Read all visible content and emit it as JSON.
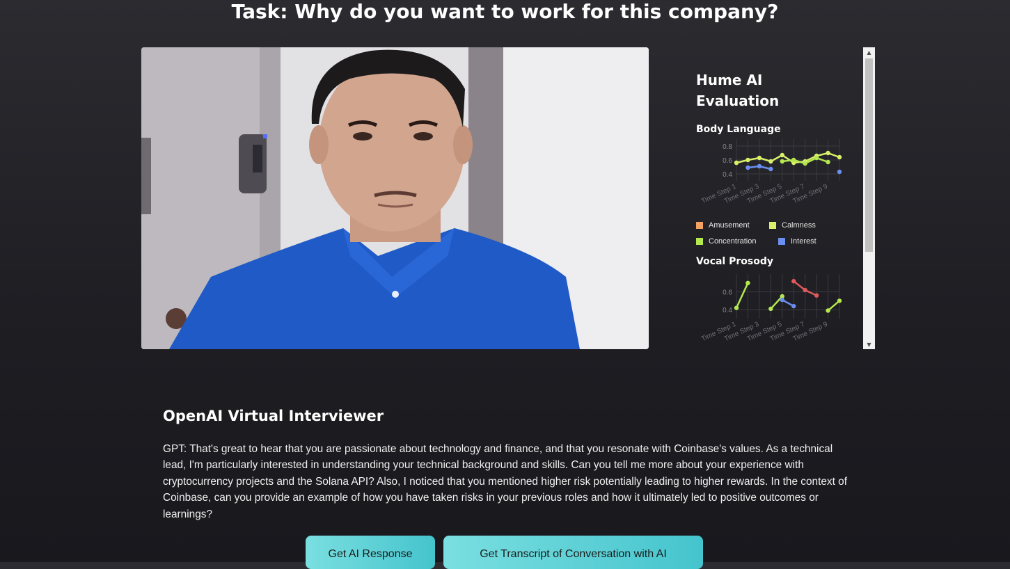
{
  "task_title": "Task: Why do you want to work for this company?",
  "evaluation": {
    "title_line1": "Hume AI",
    "title_line2": "Evaluation",
    "body_language": {
      "title": "Body Language",
      "y_ticks": [
        "0.8",
        "0.6",
        "0.4"
      ],
      "x_ticks": [
        "Time Step 1",
        "Time Step 3",
        "Time Step 5",
        "Time Step 7",
        "Time Step 9"
      ],
      "legend": [
        {
          "label": "Amusement",
          "color": "#f4a261"
        },
        {
          "label": "Calmness",
          "color": "#d9f06a"
        },
        {
          "label": "Concentration",
          "color": "#b5e84f"
        },
        {
          "label": "Interest",
          "color": "#6b8ff0"
        }
      ]
    },
    "vocal_prosody": {
      "title": "Vocal Prosody",
      "y_ticks": [
        "0.6",
        "0.4"
      ],
      "x_ticks": [
        "Time Step 1",
        "Time Step 3",
        "Time Step 5",
        "Time Step 7",
        "Time Step 9"
      ]
    }
  },
  "chart_data": [
    {
      "type": "line",
      "title": "Body Language",
      "x": [
        "Time Step 1",
        "Time Step 2",
        "Time Step 3",
        "Time Step 4",
        "Time Step 5",
        "Time Step 6",
        "Time Step 7",
        "Time Step 8",
        "Time Step 9",
        "Time Step 10"
      ],
      "ylim": [
        0.3,
        0.9
      ],
      "series": [
        {
          "name": "Amusement",
          "color": "#f4a261",
          "values": [
            0.56,
            null,
            null,
            null,
            null,
            null,
            null,
            null,
            null,
            null
          ]
        },
        {
          "name": "Calmness",
          "color": "#d9f06a",
          "values": [
            0.56,
            0.6,
            0.63,
            0.58,
            0.67,
            0.56,
            0.58,
            0.66,
            0.7,
            0.64
          ]
        },
        {
          "name": "Concentration",
          "color": "#b5e84f",
          "values": [
            null,
            null,
            null,
            null,
            0.58,
            0.6,
            0.55,
            0.63,
            0.57,
            null
          ]
        },
        {
          "name": "Interest",
          "color": "#6b8ff0",
          "values": [
            null,
            0.49,
            0.51,
            0.47,
            null,
            null,
            null,
            null,
            null,
            0.43
          ]
        }
      ]
    },
    {
      "type": "line",
      "title": "Vocal Prosody",
      "x": [
        "Time Step 1",
        "Time Step 2",
        "Time Step 3",
        "Time Step 4",
        "Time Step 5",
        "Time Step 6",
        "Time Step 7",
        "Time Step 8",
        "Time Step 9",
        "Time Step 10"
      ],
      "ylim": [
        0.3,
        0.8
      ],
      "series": [
        {
          "color": "#b5e84f",
          "values": [
            0.42,
            0.7,
            null,
            0.41,
            0.55,
            null,
            null,
            null,
            0.39,
            0.5
          ]
        },
        {
          "color": "#6b8ff0",
          "values": [
            null,
            null,
            null,
            null,
            0.51,
            0.44,
            null,
            null,
            null,
            null
          ]
        },
        {
          "color": "#e05a5a",
          "values": [
            null,
            null,
            null,
            null,
            null,
            0.72,
            0.62,
            0.56,
            null,
            null
          ]
        }
      ]
    }
  ],
  "interviewer": {
    "title": "OpenAI Virtual Interviewer",
    "message": "GPT: That's great to hear that you are passionate about technology and finance, and that you resonate with Coinbase's values. As a technical lead, I'm particularly interested in understanding your technical background and skills. Can you tell me more about your experience with cryptocurrency projects and the Solana API? Also, I noticed that you mentioned higher risk potentially leading to higher rewards. In the context of Coinbase, can you provide an example of how you have taken risks in your previous roles and how it ultimately led to positive outcomes or learnings?"
  },
  "buttons": {
    "ai_response": "Get AI Response",
    "transcript": "Get Transcript of Conversation with AI"
  }
}
